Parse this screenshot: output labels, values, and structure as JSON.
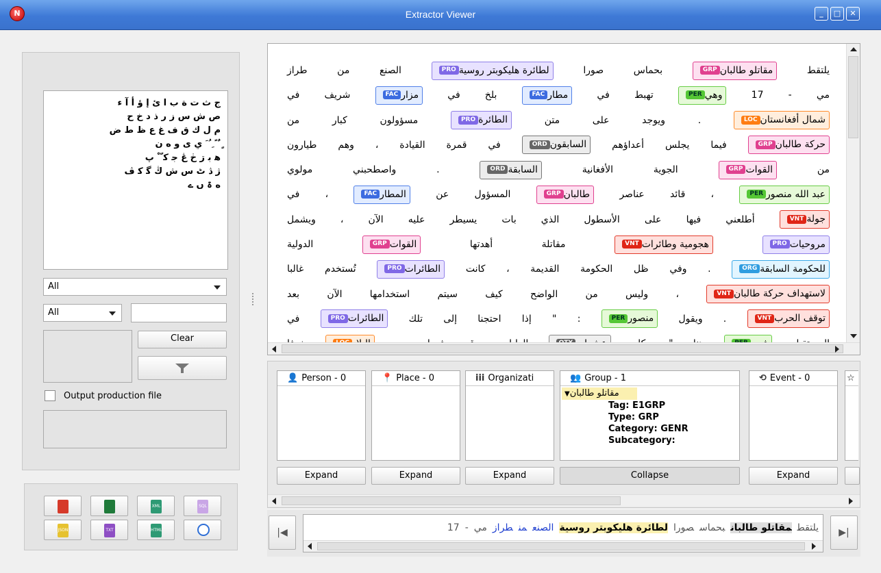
{
  "window": {
    "title": "Extractor Viewer",
    "icon": "app-logo-icon"
  },
  "left_panel": {
    "alphabet_lines": [
      "ج ث ت ة ب ا ئ إ ؤ أ آ ء",
      "ص ش س ز ر ذ د خ ح",
      "م ل ك ق ف غ ع ظ ط ض",
      "ٍ ٌ ً ِ ُ َ ي ى و ه ن",
      "ﻫ ﺑ ڗ ڂ ڠ ﺟ ﮐ ّ ْ ﭖ",
      "ژ ڎ ٹ ﺱ ﺵ ڭ ﮔ ﮐ ڤ",
      "ه ۃ ں ے"
    ],
    "filter_combo": {
      "value": "All"
    },
    "filter_combo2": {
      "value": "All"
    },
    "search_value": "",
    "clear_label": "Clear",
    "output_production_label": "Output production file"
  },
  "export_buttons": [
    {
      "name": "pdf-export-icon",
      "color": "#d63a2a",
      "label": ""
    },
    {
      "name": "excel-export-icon",
      "color": "#1f7a3a",
      "label": ""
    },
    {
      "name": "xml-export-icon",
      "color": "#2e9a74",
      "label": "XML"
    },
    {
      "name": "sql-export-icon",
      "color": "#c9a6e6",
      "label": "SQL"
    },
    {
      "name": "json-export-icon",
      "color": "#e6c230",
      "label": "JSON"
    },
    {
      "name": "txt-export-icon",
      "color": "#8e4fc4",
      "label": "TXT"
    },
    {
      "name": "html-export-icon",
      "color": "#2e9a74",
      "label": "HTML"
    },
    {
      "name": "book-export-icon",
      "color": "#2f6fd6",
      "label": ""
    }
  ],
  "text_lines": [
    [
      {
        "t": "يلتقط"
      },
      {
        "e": "GRP",
        "t": "مقاتلو طالبان"
      },
      {
        "t": "بحماس صورا"
      },
      {
        "e": "PRO",
        "t": "لطائرة هليكوبتر روسية"
      },
      {
        "t": "الصنع من طراز"
      }
    ],
    [
      {
        "t": "مي - 17"
      },
      {
        "e": "PER",
        "t": "وهي"
      },
      {
        "t": "تهبط في"
      },
      {
        "e": "FAC",
        "t": "مطار"
      },
      {
        "t": "بلخ في"
      },
      {
        "e": "FAC",
        "t": "مزار"
      },
      {
        "t": "شريف في"
      }
    ],
    [
      {
        "e": "LOC",
        "t": "شمال أفغانستان"
      },
      {
        "t": ". ويوجد على متن"
      },
      {
        "e": "PRO",
        "t": "الطائرة"
      },
      {
        "t": "مسؤولون كبار من"
      }
    ],
    [
      {
        "e": "GRP",
        "t": "حركة طالبان"
      },
      {
        "t": "فيما يجلس أعداؤهم"
      },
      {
        "e": "ORD",
        "t": "السابقون"
      },
      {
        "t": "في قمرة القيادة ، وهم طيارون"
      }
    ],
    [
      {
        "t": "من"
      },
      {
        "e": "GRP",
        "t": "القوات"
      },
      {
        "t": "الجوية الأفغانية"
      },
      {
        "e": "ORD",
        "t": "السابقة"
      },
      {
        "t": ". واصطحبني مولوي"
      }
    ],
    [
      {
        "e": "PER",
        "t": "عبد الله منصور"
      },
      {
        "t": "، قائد عناصر"
      },
      {
        "e": "GRP",
        "t": "طالبان"
      },
      {
        "t": "المسؤول عن"
      },
      {
        "e": "FAC",
        "t": "المطار"
      },
      {
        "t": "، في"
      }
    ],
    [
      {
        "e": "VNT",
        "t": "جولة"
      },
      {
        "t": "أطلعني فيها على الأسطول الذي بات يسيطر عليه الآن ، ويشمل"
      }
    ],
    [
      {
        "e": "PRO",
        "t": "مروحيات"
      },
      {
        "e": "VNT",
        "t": "هجومية وطائرات"
      },
      {
        "t": "مقاتلة أهدتها"
      },
      {
        "e": "GRP",
        "t": "القوات"
      },
      {
        "t": "الدولية"
      }
    ],
    [
      {
        "e": "ORG",
        "t": "للحكومة السابقة"
      },
      {
        "t": ". وفي ظل الحكومة القديمة ، كانت"
      },
      {
        "e": "PRO",
        "t": "الطائرات"
      },
      {
        "t": "تُستخدم غالبا"
      }
    ],
    [
      {
        "e": "VNT",
        "t": "لاستهداف حركة طالبان"
      },
      {
        "t": "، وليس من الواضح كيف سيتم استخدامها الآن بعد"
      }
    ],
    [
      {
        "e": "VNT",
        "t": "توقف الحرب"
      },
      {
        "t": ". ويقول"
      },
      {
        "e": "PER",
        "t": "منصور"
      },
      {
        "t": ": \" إذا احتجنا إلى تلك"
      },
      {
        "e": "PRO",
        "t": "الطائرات"
      },
      {
        "t": "في"
      }
    ],
    [
      {
        "t": "المستقبل"
      },
      {
        "e": "PER",
        "t": "فهي"
      },
      {
        "t": "هنا \". كان"
      },
      {
        "e": "QTY",
        "t": "عشرات"
      },
      {
        "t": "الطيارين قد فروا من"
      },
      {
        "e": "LOC",
        "t": "البلاد"
      },
      {
        "t": "خوفا"
      }
    ]
  ],
  "entity_columns": [
    {
      "icon": "person-icon",
      "glyph": "👤",
      "label": "Person - 0",
      "button": "Expand"
    },
    {
      "icon": "place-icon",
      "glyph": "📍",
      "label": "Place - 0",
      "button": "Expand"
    },
    {
      "icon": "organization-icon",
      "glyph": "iii",
      "label": "Organizati",
      "button": "Expand"
    },
    {
      "icon": "group-icon",
      "glyph": "👥",
      "label": "Group - 1",
      "button": "Collapse"
    },
    {
      "icon": "event-icon",
      "glyph": "⟲",
      "label": "Event - 0",
      "button": "Expand"
    }
  ],
  "group_entry": {
    "name": "مقاتلو طالبان",
    "tag": "Tag: E1GRP",
    "type": "Type: GRP",
    "category": "Category: GENR",
    "subcategory": "Subcategory:"
  },
  "nav_tokens": [
    {
      "t": "يلتقط",
      "c": "plain"
    },
    {
      "t": "مقاتلو طالبان",
      "c": "hl2"
    },
    {
      "t": "بحماس",
      "c": "plain"
    },
    {
      "t": "صورا",
      "c": "plain"
    },
    {
      "t": "لطائرة هليكوبتر روسية",
      "c": "hl"
    },
    {
      "t": "الصنع",
      "c": "blue"
    },
    {
      "t": "من",
      "c": "blue"
    },
    {
      "t": "طراز",
      "c": "blue"
    },
    {
      "t": "مي",
      "c": "plain"
    },
    {
      "t": "-",
      "c": "plain"
    },
    {
      "t": "17",
      "c": "plain"
    }
  ]
}
